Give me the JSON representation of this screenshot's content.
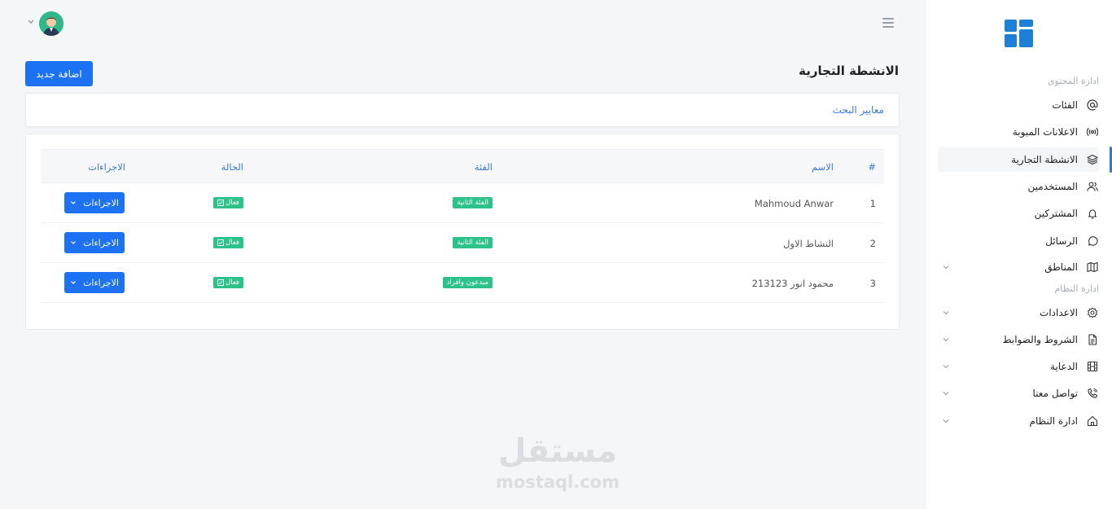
{
  "header": {
    "page_title": "الانشطة التجارية",
    "add_button": "اضافة جديد"
  },
  "search": {
    "label": "معايير البحث"
  },
  "table": {
    "columns": [
      "#",
      "الاسم",
      "الفئة",
      "الحالة",
      "الاجراءات"
    ],
    "rows": [
      {
        "num": "1",
        "name": "Mahmoud Anwar",
        "category": "الفئة الثانية",
        "status": "فعال",
        "action": "الاجراءات"
      },
      {
        "num": "2",
        "name": "النشاط الاول",
        "category": "الفئة الثانية",
        "status": "فعال",
        "action": "الاجراءات"
      },
      {
        "num": "3",
        "name": "محمود انور 213123",
        "category": "مبدعون وافراد",
        "status": "فعال",
        "action": "الاجراءات"
      }
    ]
  },
  "sidebar": {
    "section_content": "ادارة المحتوى",
    "section_system": "ادارة النظام",
    "items": [
      {
        "label": "الفئات",
        "icon": "at-icon"
      },
      {
        "label": "الاعلانات المبوبة",
        "icon": "broadcast-icon"
      },
      {
        "label": "الانشطة التجارية",
        "icon": "layers-icon"
      },
      {
        "label": "المستخدمين",
        "icon": "users-icon"
      },
      {
        "label": "المشتركين",
        "icon": "bell-icon"
      },
      {
        "label": "الرسائل",
        "icon": "message-icon"
      },
      {
        "label": "المناطق",
        "icon": "map-icon"
      },
      {
        "label": "الاعدادات",
        "icon": "gear-icon"
      },
      {
        "label": "الشروط والضوابط",
        "icon": "document-icon"
      },
      {
        "label": "الدعاية",
        "icon": "film-icon"
      },
      {
        "label": "تواصل معنا",
        "icon": "phone-icon"
      },
      {
        "label": "ادارة النظام",
        "icon": "home-icon"
      }
    ]
  },
  "watermark": {
    "arabic": "مستقل",
    "english": "mostaql.com"
  },
  "colors": {
    "primary": "#1d72f3",
    "success": "#2ec28b",
    "link": "#3a7ad4",
    "logo": "#1e7fd6"
  }
}
